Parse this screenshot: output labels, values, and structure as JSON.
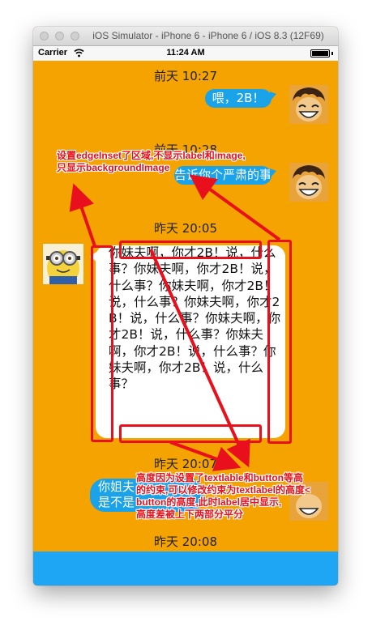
{
  "window": {
    "title": "iOS Simulator - iPhone 6 - iPhone 6 / iOS 8.3 (12F69)"
  },
  "status_bar": {
    "carrier": "Carrier",
    "time": "11:24 AM"
  },
  "messages": {
    "timestamps": [
      "前天 10:27",
      "前天 10:28",
      "昨天 20:05",
      "昨天 20:07",
      "昨天 20:08"
    ],
    "bubble1": "喂，2B！",
    "bubble2": "告诉你个严肃的事",
    "long_message": "你妹夫啊，你才2B！说，什么事？你妹夫啊，你才2B！说，什么事？你妹夫啊，你才2B！说，什么事？你妹夫啊，你才2B！说，什么事？你妹夫啊，你才2B！说，什么事？你妹夫啊，你才2B！说，什么事？你妹夫啊，你才2B！说，什么事？",
    "bubble4_line1": "你姐夫",
    "bubble4_line2": "是不是"
  },
  "annotations": {
    "top_line1": "设置edgeInset了区域,不显示label和image,",
    "top_line2": "只显示backgroundImage",
    "bottom_line1": "高度因为设置了textlable和button等高",
    "bottom_line2": "的约束,可以修改约束为textlabel的高度<",
    "bottom_line3": "button的高度,此时label居中显示,",
    "bottom_line4": "高度差被上下两部分平分"
  },
  "colors": {
    "chat_background": "#f5a300",
    "bubble_blue": "#1aa3e8",
    "annotation_red": "#e8101c",
    "bottom_bar": "#1ea6f5"
  },
  "icons": [
    "wifi-icon",
    "battery-icon",
    "luffy-avatar",
    "minion-avatar"
  ]
}
